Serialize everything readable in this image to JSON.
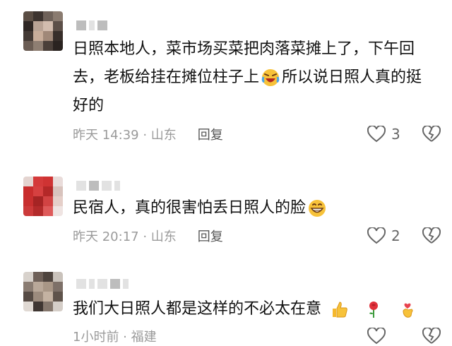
{
  "comments": [
    {
      "text": "日照本地人，菜市场买菜把肉落菜摊上了，下午回去，老板给挂在摊位柱子上",
      "text_after_emoji": "所以说日照人真的挺好的",
      "emoji_icon": "laughing-tears-emoji",
      "time": "昨天 14:39 · 山东",
      "reply": "回复",
      "likes": "3"
    },
    {
      "text": "民宿人，真的很害怕丢日照人的脸",
      "emoji_icon": "grinning-emoji",
      "time": "昨天 20:17 · 山东",
      "reply": "回复",
      "likes": "2"
    },
    {
      "text": "我们大日照人都是这样的不必太在意",
      "emoji_icons": [
        "thumbs-up-emoji",
        "rose-emoji",
        "finger-heart-emoji"
      ],
      "time": "1小时前 · 福建"
    }
  ]
}
